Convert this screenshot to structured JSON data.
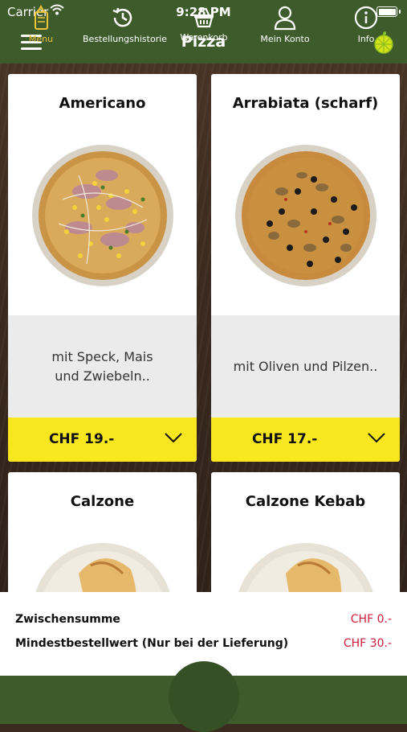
{
  "status": {
    "carrier": "Carrier",
    "time": "9:28 PM"
  },
  "nav": {
    "title": "Pizza",
    "menu_icon": "hamburger-icon",
    "logo_icon": "lime-logo-icon"
  },
  "products": [
    {
      "name": "Americano",
      "description": "mit Speck, Mais und Zwiebeln..",
      "price": "CHF 19.-"
    },
    {
      "name": "Arrabiata (scharf)",
      "description": "mit Oliven und Pilzen..",
      "price": "CHF 17.-"
    },
    {
      "name": "Calzone"
    },
    {
      "name": "Calzone Kebab"
    }
  ],
  "summary": {
    "subtotal_label": "Zwischensumme",
    "subtotal_value": "CHF 0.-",
    "minimum_label": "Mindestbestellwert (Nur bei der Lieferung)",
    "minimum_value": "CHF 30.-"
  },
  "tabs": [
    {
      "label": "Menu",
      "icon": "menu-card-icon",
      "active": true
    },
    {
      "label": "Bestellungshistorie",
      "icon": "history-icon"
    },
    {
      "label": "Warenkorb",
      "icon": "basket-icon"
    },
    {
      "label": "Mein Konto",
      "icon": "person-icon"
    },
    {
      "label": "Info",
      "icon": "info-icon"
    }
  ],
  "colors": {
    "primary": "#3e5b2c",
    "price_bar": "#f8e61e",
    "accent_red": "#d01a3a",
    "active_tab": "#f0c43a"
  }
}
